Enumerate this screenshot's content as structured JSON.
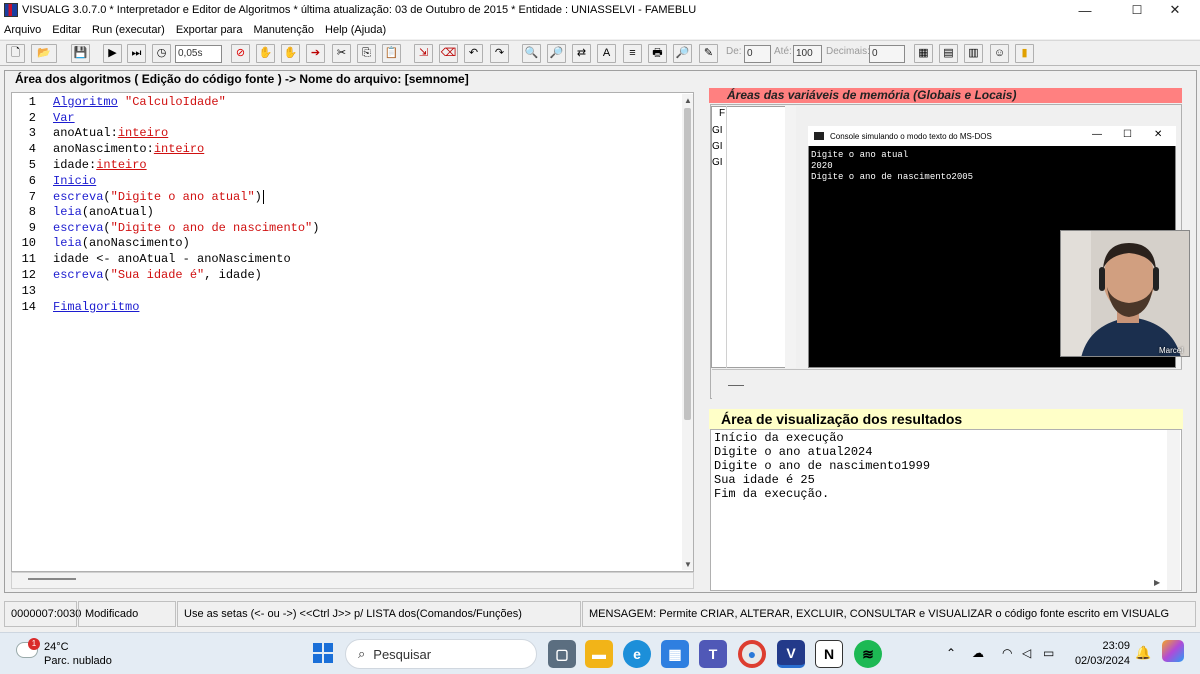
{
  "window": {
    "title": "VISUALG 3.0.7.0 * Interpretador e Editor de Algoritmos * última atualização: 03 de Outubro de 2015 * Entidade : UNIASSELVI - FAMEBLU",
    "min": "—",
    "max": "☐",
    "close": "✕"
  },
  "menu": [
    "Arquivo",
    "Editar",
    "Run (executar)",
    "Exportar para",
    "Manutenção",
    "Help (Ajuda)"
  ],
  "toolbar": {
    "speed": "0,05s",
    "de_label": "De:",
    "de_value": "0",
    "ate_label": "Até:",
    "ate_value": "100",
    "decimais_label": "Decimais:",
    "decimais_value": "0"
  },
  "editor": {
    "title": "Área dos algoritmos ( Edição do código fonte ) -> Nome do arquivo: [semnome]",
    "lines": [
      "1",
      "2",
      "3",
      "4",
      "5",
      "6",
      "7",
      "8",
      "9",
      "10",
      "11",
      "12",
      "13",
      "14"
    ],
    "tokens": {
      "l1a": "Algoritmo",
      "l1b": " \"CalculoIdade\"",
      "l2": "Var",
      "l3a": "anoAtual:",
      "l3b": "inteiro",
      "l4a": "anoNascimento:",
      "l4b": "inteiro",
      "l5a": "idade:",
      "l5b": "inteiro",
      "l6": "Inicio",
      "l7a": "escreva",
      "l7b": "(",
      "l7c": "\"Digite o ano atual\"",
      "l7d": ")",
      "l8a": "leia",
      "l8b": "(anoAtual)",
      "l9a": "escreva",
      "l9b": "(",
      "l9c": "\"Digite o ano de nascimento\"",
      "l9d": ")",
      "l10a": "leia",
      "l10b": "(anoNascimento)",
      "l11": "idade <- anoAtual - anoNascimento",
      "l12a": "escreva",
      "l12b": "(",
      "l12c": "\"Sua idade é\"",
      "l12d": ", idade)",
      "l14": "Fimalgoritmo"
    }
  },
  "vars": {
    "title": "Áreas das variáveis de memória (Globais e Locais)",
    "rows": [
      "GI",
      "GI",
      "GI"
    ],
    "header": "F"
  },
  "console": {
    "title": "Console simulando o modo texto do MS-DOS",
    "lines": [
      "Digite o ano atual",
      "2020",
      "Digite o ano de nascimento2005"
    ]
  },
  "webcam": {
    "caption": "Marcel Ra"
  },
  "results": {
    "title": "Área de visualização dos resultados",
    "lines": [
      "Início da execução",
      "Digite o ano atual2024",
      "Digite o ano de nascimento1999",
      "Sua idade é 25",
      "Fim da execução."
    ]
  },
  "status": {
    "position": "0000007:0030",
    "state": "Modificado",
    "hint": "Use as setas (<- ou ->) <<Ctrl J>> p/ LISTA dos(Comandos/Funções)",
    "message": "MENSAGEM: Permite CRIAR, ALTERAR, EXCLUIR, CONSULTAR e VISUALIZAR o código fonte escrito em VISUALG"
  },
  "taskbar": {
    "weather_temp": "24°C",
    "weather_desc": "Parc. nublado",
    "weather_badge": "1",
    "search_placeholder": "Pesquisar",
    "time": "23:09",
    "date": "02/03/2024"
  }
}
